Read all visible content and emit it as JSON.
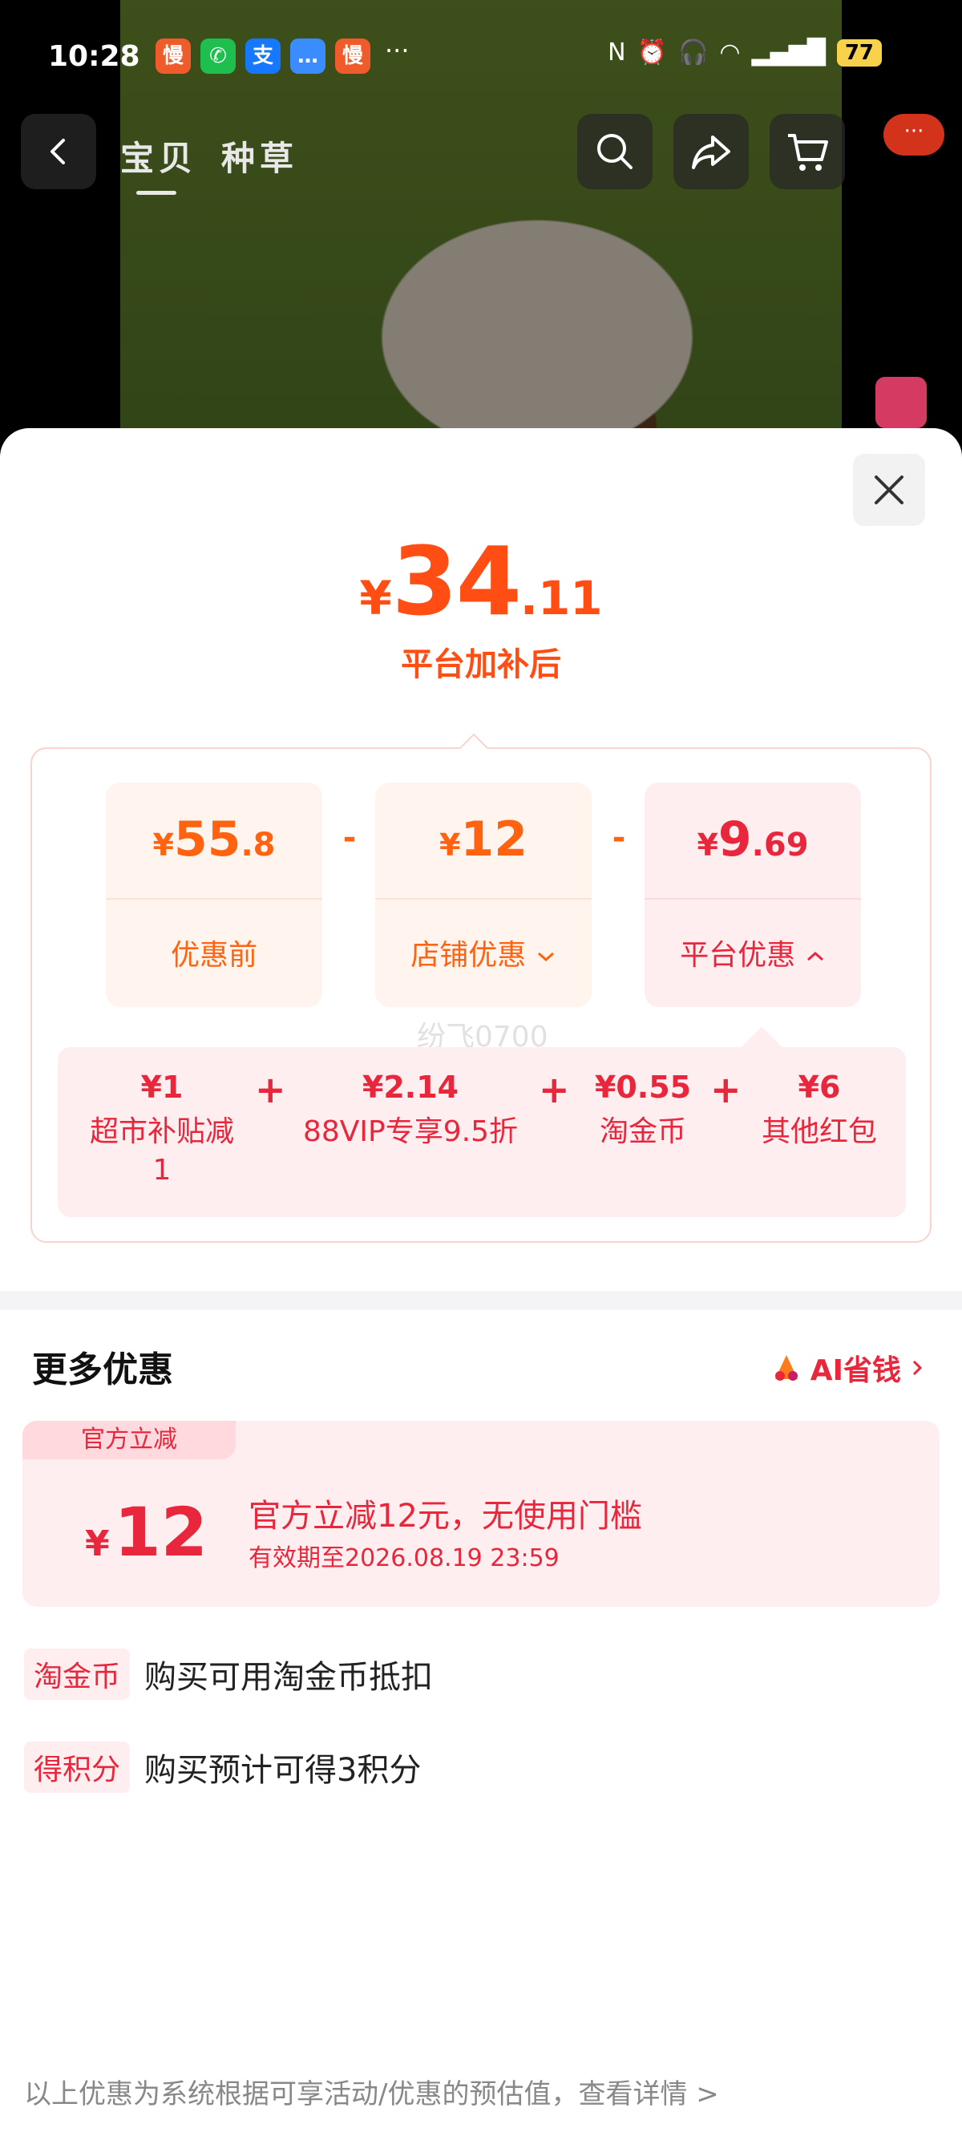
{
  "status_bar": {
    "time": "10:28",
    "apps": [
      {
        "name": "app-manbi-icon",
        "glyph": "慢",
        "color": "#ef5b2b"
      },
      {
        "name": "wechat-icon",
        "glyph": "✆",
        "color": "#1fbf4f"
      },
      {
        "name": "alipay-icon",
        "glyph": "支",
        "color": "#1677ff"
      },
      {
        "name": "message-icon",
        "glyph": "…",
        "color": "#3b8cff"
      },
      {
        "name": "app-manbi-icon-2",
        "glyph": "慢",
        "color": "#ef5b2b"
      }
    ],
    "more": "···",
    "battery": "77"
  },
  "topnav": {
    "tabs": [
      "宝贝",
      "种草"
    ],
    "message_badge": "···"
  },
  "price": {
    "currency": "¥",
    "integer": "34",
    "decimal": ".11",
    "subtitle": "平台加补后"
  },
  "breakdown": {
    "before": {
      "currency": "¥",
      "integer": "55",
      "decimal": ".8",
      "label": "优惠前"
    },
    "minus": "-",
    "shop": {
      "currency": "¥",
      "integer": "12",
      "decimal": "",
      "label": "店铺优惠"
    },
    "platform": {
      "currency": "¥",
      "integer": "9",
      "decimal": ".69",
      "label": "平台优惠"
    },
    "plus": "+",
    "platform_items": [
      {
        "value": "¥1",
        "label": "超市补贴减1"
      },
      {
        "value": "¥2.14",
        "label": "88VIP专享9.5折"
      },
      {
        "value": "¥0.55",
        "label": "淘金币"
      },
      {
        "value": "¥6",
        "label": "其他红包"
      }
    ],
    "watermark": "纷飞0700"
  },
  "more_offers": {
    "title": "更多优惠",
    "ai_link": "AI省钱"
  },
  "coupon": {
    "tag": "官方立减",
    "currency": "¥",
    "amount": "12",
    "title": "官方立减12元，无使用门槛",
    "validity": "有效期至2026.08.19 23:59"
  },
  "info_rows": [
    {
      "badge": "淘金币",
      "text": "购买可用淘金币抵扣"
    },
    {
      "badge": "得积分",
      "text": "购买预计可得3积分"
    }
  ],
  "footer_note": "以上优惠为系统根据可享活动/优惠的预估值，查看详情 >"
}
